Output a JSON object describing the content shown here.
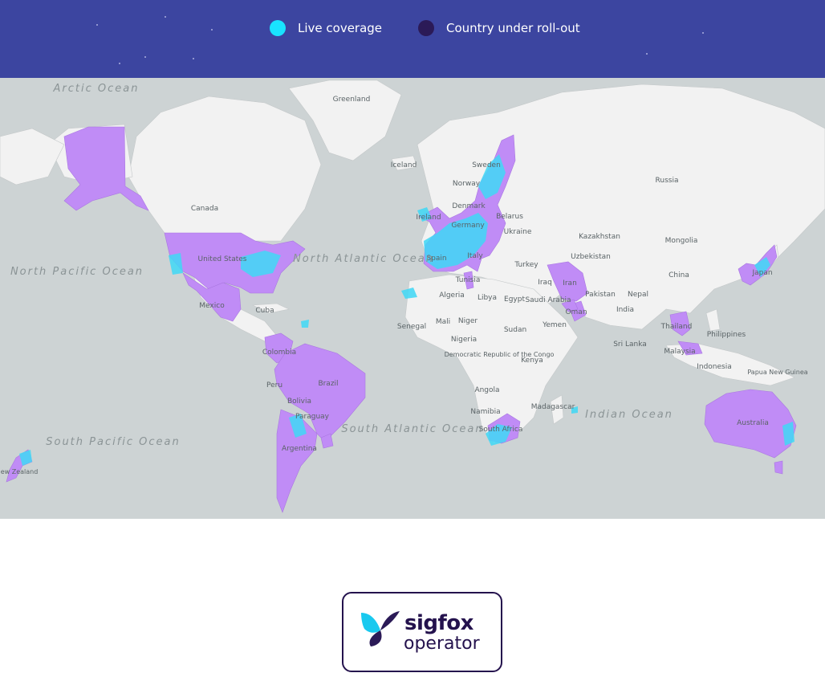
{
  "legend": {
    "items": [
      {
        "label": "Live coverage",
        "color": "#19e3ff"
      },
      {
        "label": "Country under roll-out",
        "color": "#2b1a57"
      }
    ]
  },
  "map": {
    "colors": {
      "ocean": "#cdd3d4",
      "land": "#f2f2f2",
      "rollout": "#c08cf6",
      "coverage": "#3fd8f6"
    },
    "country_labels": [
      "Greenland",
      "Iceland",
      "Sweden",
      "Norway",
      "Russia",
      "Canada",
      "Denmark",
      "Ireland",
      "Belarus",
      "Germany",
      "Ukraine",
      "Kazakhstan",
      "Mongolia",
      "Uzbekistan",
      "Spain",
      "Italy",
      "Turkey",
      "United States",
      "Tunisia",
      "Iraq",
      "Iran",
      "China",
      "Japan",
      "Algeria",
      "Libya",
      "Egypt",
      "Pakistan",
      "Nepal",
      "Mexico",
      "Cuba",
      "Saudi Arabia",
      "India",
      "Oman",
      "Senegal",
      "Mali",
      "Niger",
      "Sudan",
      "Yemen",
      "Thailand",
      "Philippines",
      "Nigeria",
      "Sri Lanka",
      "Colombia",
      "Malaysia",
      "Democratic Republic of the Congo",
      "Kenya",
      "Indonesia",
      "Papua New Guinea",
      "Brazil",
      "Peru",
      "Angola",
      "Bolivia",
      "Paraguay",
      "Namibia",
      "Madagascar",
      "South Africa",
      "Australia",
      "Argentina",
      "New Zealand"
    ],
    "ocean_labels": [
      "Arctic Ocean",
      "North Pacific Ocean",
      "North Atlantic Ocean",
      "South Pacific Ocean",
      "South Atlantic Ocean",
      "Indian Ocean"
    ]
  },
  "logo": {
    "brand": "sigfox",
    "sub": "operator",
    "border_color": "#24124d"
  }
}
